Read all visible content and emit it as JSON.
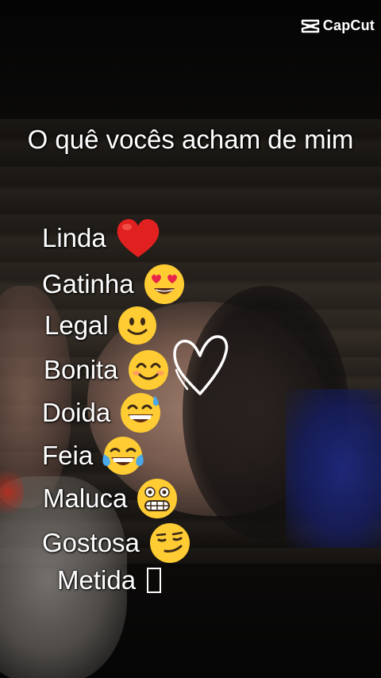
{
  "logo": {
    "text": "CapCut",
    "icon": "capcut-logo-icon"
  },
  "title": "O quê vocês acham de mim",
  "options": [
    {
      "label": "Linda",
      "emoji": "red-heart-icon"
    },
    {
      "label": "Gatinha",
      "emoji": "heart-eyes-icon"
    },
    {
      "label": "Legal",
      "emoji": "slightly-smiling-icon"
    },
    {
      "label": "Bonita",
      "emoji": "smiling-eyes-icon"
    },
    {
      "label": "Doida",
      "emoji": "grinning-sweat-icon"
    },
    {
      "label": "Feia",
      "emoji": "tears-of-joy-icon"
    },
    {
      "label": "Maluca",
      "emoji": "grimacing-icon"
    },
    {
      "label": "Gostosa",
      "emoji": "smirking-icon"
    },
    {
      "label": "Metida",
      "emoji": "missing-glyph-box"
    }
  ],
  "decoration": {
    "icon": "white-heart-outline-icon"
  },
  "colors": {
    "text": "#ffffff",
    "heart": "#e0211f",
    "emoji_face": "#ffcc33"
  }
}
